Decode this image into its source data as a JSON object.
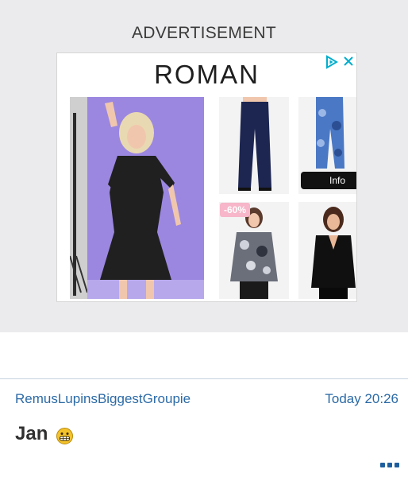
{
  "ad": {
    "label": "ADVERTISEMENT",
    "brand": "ROMAN",
    "discount_badge": "-60%",
    "info_button": "Info",
    "icons": {
      "adchoices": "adchoices-icon",
      "close": "close-icon"
    }
  },
  "post": {
    "username": "RemusLupinsBiggestGroupie",
    "timestamp": "Today 20:26",
    "text": "Jan",
    "emoji": "grimacing-emoji-icon",
    "more": "more-options-icon"
  },
  "colors": {
    "link": "#2b6aa6",
    "ad_background": "#ebebed",
    "adchoices": "#00aecd",
    "more_button": "#1f5e9e"
  }
}
